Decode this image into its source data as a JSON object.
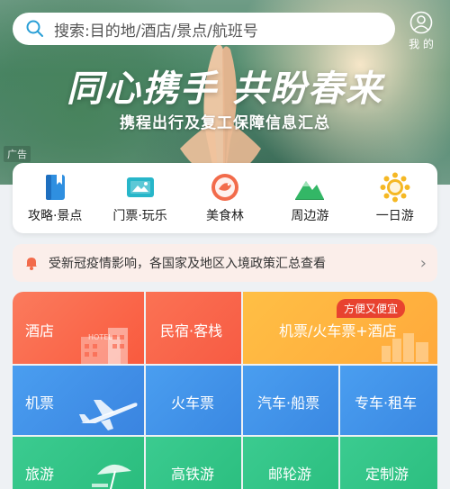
{
  "search": {
    "placeholder": "搜索:目的地/酒店/景点/航班号"
  },
  "me": {
    "label": "我 的"
  },
  "banner": {
    "title": "同心携手 共盼春来",
    "subtitle": "携程出行及复工保障信息汇总",
    "ad_tag": "广告"
  },
  "categories": [
    {
      "label": "攻略·景点",
      "icon": "guide-book-icon"
    },
    {
      "label": "门票·玩乐",
      "icon": "ticket-icon"
    },
    {
      "label": "美食林",
      "icon": "food-icon"
    },
    {
      "label": "周边游",
      "icon": "mountain-icon"
    },
    {
      "label": "一日游",
      "icon": "sun-icon"
    }
  ],
  "notice": {
    "text": "受新冠疫情影响，各国家及地区入境政策汇总查看"
  },
  "grid": {
    "hotel": "酒店",
    "homestay": "民宿·客栈",
    "flight_train_hotel": "机票/火车票+酒店",
    "promo_badge": "方便又便宜",
    "flight": "机票",
    "train": "火车票",
    "bus_ship": "汽车·船票",
    "car_rental": "专车·租车",
    "travel": "旅游",
    "high_speed_rail": "高铁游",
    "cruise": "邮轮游",
    "custom": "定制游",
    "hotel_sign": "HOTEL"
  },
  "colors": {
    "hotel_tile": "#fb6a4a",
    "flight_tile": "#3f8fe6",
    "travel_tile": "#34c38a"
  }
}
